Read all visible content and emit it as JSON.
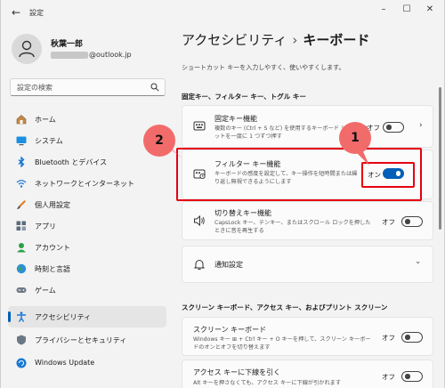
{
  "window": {
    "title": "設定"
  },
  "user": {
    "name": "秋葉一郎",
    "email_suffix": "@outlook.jp"
  },
  "search": {
    "placeholder": "設定の検索"
  },
  "nav": [
    {
      "label": "ホーム",
      "icon": "home-icon"
    },
    {
      "label": "システム",
      "icon": "system-icon"
    },
    {
      "label": "Bluetooth とデバイス",
      "icon": "bluetooth-icon"
    },
    {
      "label": "ネットワークとインターネット",
      "icon": "wifi-icon"
    },
    {
      "label": "個人用設定",
      "icon": "brush-icon"
    },
    {
      "label": "アプリ",
      "icon": "apps-icon"
    },
    {
      "label": "アカウント",
      "icon": "account-icon"
    },
    {
      "label": "時刻と言語",
      "icon": "globe-icon"
    },
    {
      "label": "ゲーム",
      "icon": "gamepad-icon"
    },
    {
      "label": "アクセシビリティ",
      "icon": "accessibility-icon",
      "active": true
    },
    {
      "label": "プライバシーとセキュリティ",
      "icon": "shield-icon"
    },
    {
      "label": "Windows Update",
      "icon": "update-icon"
    }
  ],
  "breadcrumb": {
    "parent": "アクセシビリティ",
    "separator": "›",
    "current": "キーボード"
  },
  "subtitle": "ショートカット キーを入力しやすく、使いやすくします。",
  "section1": {
    "title": "固定キー、フィルター キー、トグル キー"
  },
  "settings": {
    "sticky": {
      "title": "固定キー機能",
      "desc": "複数のキー (Ctrl + S など) を使用するキーボード ショートカットを一度に 1 つずつ押す",
      "state": "オフ"
    },
    "filter": {
      "title": "フィルター キー機能",
      "desc": "キーボードの感度を設定して、キー操作を短時間または繰り返し無視できるようにします",
      "state": "オン"
    },
    "toggle": {
      "title": "切り替えキー機能",
      "desc": "CapsLock キー、テンキー、またはスクロール ロックを押したときに音を再生する",
      "state": "オフ"
    },
    "notify": {
      "title": "通知設定"
    }
  },
  "section2": {
    "title": "スクリーン キーボード、アクセス キー、およびプリント スクリーン"
  },
  "settings2": {
    "osk": {
      "title": "スクリーン キーボード",
      "desc": "Windows キー ⊞ + Ctrl キー + O キーを押して、スクリーン キーボードのオンとオフを切り替えます",
      "state": "オフ"
    },
    "access": {
      "title": "アクセス キーに下線を引く",
      "desc": "Alt キーを押さなくても、アクセス キーに下線が引かれます",
      "state": "オフ"
    }
  },
  "callouts": {
    "one": "1",
    "two": "2"
  },
  "colors": {
    "accent": "#005fb8",
    "highlight": "#e60012",
    "callout": "#f26b6b"
  }
}
